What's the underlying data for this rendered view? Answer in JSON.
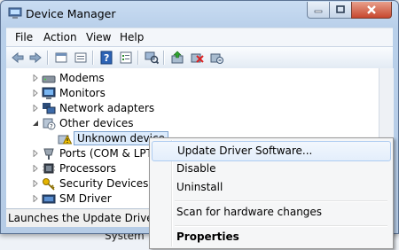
{
  "background": {
    "partial_text": "System"
  },
  "window": {
    "title": "Device Manager",
    "menu": [
      "File",
      "Action",
      "View",
      "Help"
    ],
    "toolbar_icons": [
      "back-icon",
      "forward-icon",
      "up-icon",
      "show-hide-icon",
      "help-icon",
      "properties-icon",
      "scan-hardware-icon",
      "update-driver-icon",
      "disable-device-icon",
      "uninstall-device-icon"
    ]
  },
  "tree": {
    "items": [
      {
        "label": "Modems",
        "icon": "modem-icon",
        "expander": "collapsed"
      },
      {
        "label": "Monitors",
        "icon": "monitor-icon",
        "expander": "collapsed"
      },
      {
        "label": "Network adapters",
        "icon": "network-adapter-icon",
        "expander": "collapsed"
      },
      {
        "label": "Other devices",
        "icon": "other-devices-icon",
        "expander": "expanded"
      },
      {
        "label": "Unknown device",
        "icon": "warning-device-icon",
        "expander": "none",
        "selected": true
      },
      {
        "label": "Ports (COM & LPT)",
        "icon": "port-icon",
        "expander": "collapsed"
      },
      {
        "label": "Processors",
        "icon": "processor-icon",
        "expander": "collapsed"
      },
      {
        "label": "Security Devices",
        "icon": "security-key-icon",
        "expander": "collapsed"
      },
      {
        "label": "SM Driver",
        "icon": "driver-icon",
        "expander": "collapsed"
      }
    ]
  },
  "status": {
    "text": "Launches the Update Driver Soft"
  },
  "context_menu": {
    "items": [
      {
        "label": "Update Driver Software...",
        "highlighted": true
      },
      {
        "label": "Disable"
      },
      {
        "label": "Uninstall"
      },
      {
        "label": "Scan for hardware changes"
      },
      {
        "label": "Properties",
        "bold": true
      }
    ]
  },
  "colors": {
    "window_frame": "#b9d0ea",
    "menu_highlight": "#e3eefb",
    "selection": "#dcebfc"
  }
}
